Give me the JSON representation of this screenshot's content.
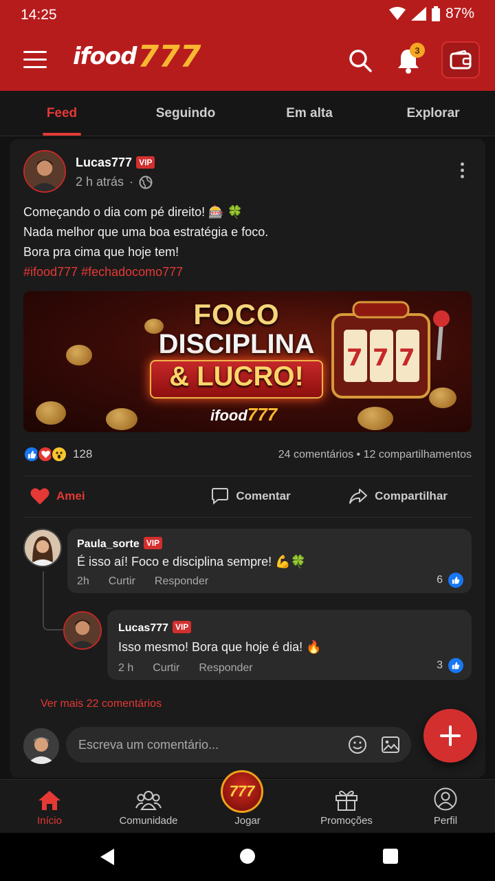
{
  "status_bar": {
    "time": "14:25",
    "battery": "87%"
  },
  "app_bar": {
    "logo_text": "ifood",
    "logo_number": "777",
    "notification_count": "3"
  },
  "tabs": [
    {
      "label": "Feed",
      "active": true
    },
    {
      "label": "Seguindo",
      "active": false
    },
    {
      "label": "Em alta",
      "active": false
    },
    {
      "label": "Explorar",
      "active": false
    }
  ],
  "post": {
    "author": "Lucas777",
    "badge": "VIP",
    "time": "2 h atrás",
    "separator": "·",
    "lines": [
      "Começando o dia com pé direito! 🎰 🍀",
      "Nada melhor que uma boa estratégia e foco.",
      "Bora pra cima que hoje tem!"
    ],
    "hashtags": "#ifood777 #fechadocomo777",
    "banner": {
      "line1": "FOCO",
      "line2": "DISCIPLINA",
      "line3": "& LUCRO!",
      "logo_text": "ifood",
      "logo_number": "777"
    },
    "reaction_count": "128",
    "stats": "24 comentários • 12 compartilhamentos",
    "actions": {
      "like": "Amei",
      "comment": "Comentar",
      "share": "Compartilhar"
    }
  },
  "comments": [
    {
      "author": "Paula_sorte",
      "badge": "VIP",
      "text": "É isso aí! Foco e disciplina sempre! 💪🍀",
      "time": "2h",
      "like_label": "Curtir",
      "reply_label": "Responder",
      "likes": "6"
    },
    {
      "author": "Lucas777",
      "badge": "VIP",
      "text": "Isso mesmo! Bora que hoje é dia! 🔥",
      "time": "2 h",
      "like_label": "Curtir",
      "reply_label": "Responder",
      "likes": "3"
    }
  ],
  "more_comments": "Ver mais 22 comentários",
  "comment_input": {
    "placeholder": "Escreva um comentário..."
  },
  "bottom_nav": [
    {
      "label": "Início",
      "icon": "home-icon",
      "active": true
    },
    {
      "label": "Comunidade",
      "icon": "community-icon",
      "active": false
    },
    {
      "label": "Jogar",
      "icon": "777-icon",
      "badge_text": "777",
      "active": false
    },
    {
      "label": "Promoções",
      "icon": "gift-icon",
      "active": false
    },
    {
      "label": "Perfil",
      "icon": "profile-icon",
      "active": false
    }
  ],
  "colors": {
    "brand_red": "#b71c1c",
    "accent_red": "#e53935",
    "gold": "#f7b731",
    "background": "#121212"
  }
}
